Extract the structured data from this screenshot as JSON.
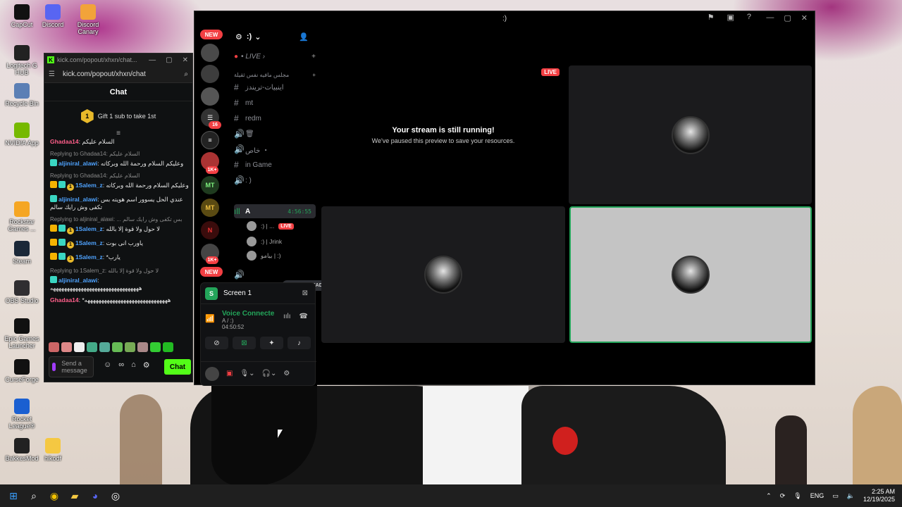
{
  "desktop": {
    "icons": [
      {
        "label": "CapCut",
        "color": "#111"
      },
      {
        "label": "Discord",
        "color": "#5865f2"
      },
      {
        "label": "Discord Canary",
        "color": "#f2a33a"
      },
      {
        "label": "Logitech G HUB",
        "color": "#222"
      },
      {
        "label": "Recycle Bin",
        "color": "#5b7fb5"
      },
      {
        "label": "NVIDIA App",
        "color": "#76b900"
      },
      {
        "label": "Rockstar Games ...",
        "color": "#f5a623"
      },
      {
        "label": "Steam",
        "color": "#1b2838"
      },
      {
        "label": "OBS Studio",
        "color": "#302e31"
      },
      {
        "label": "Epic Games Launcher",
        "color": "#111"
      },
      {
        "label": "CurseForge",
        "color": "#111"
      },
      {
        "label": "Rocket League®",
        "color": "#1a5fd1"
      },
      {
        "label": "BakkesMod",
        "color": "#222"
      },
      {
        "label": "hikodf",
        "color": "#f5c842"
      }
    ]
  },
  "kick": {
    "title": "kick.com/popout/xhxn/chat...",
    "url": "kick.com/popout/xhxn/chat",
    "chat_header": "Chat",
    "gift": {
      "badge": "1",
      "text": "Gift 1 sub to take 1st"
    },
    "messages": [
      {
        "reply": "",
        "user": "Ghadaa14",
        "color": "pink",
        "text": "السلام عليكم"
      },
      {
        "reply": "Replying to Ghadaa14: السلام عليكم",
        "user": "aljiniral_alawi",
        "color": "blue",
        "text": "وعليكم السلام ورحمة الله وبركاته"
      },
      {
        "reply": "Replying to Ghadaa14: السلام عليكم",
        "user": "1Salem_z",
        "color": "blue",
        "text": "وعليكم السلام ورحمة الله وبركاته"
      },
      {
        "reply": "",
        "user": "aljiniral_alawi",
        "color": "blue",
        "text": "عندي الحل يسوور اسم هويته بس تكفى وش رايك سالم"
      },
      {
        "reply": "Replying to aljiniral_alawi: ... بس تكفى وش رايك سالم",
        "user": "1Salem_z",
        "color": "blue",
        "text": "لا حول ولا قوة إلا بالله"
      },
      {
        "reply": "",
        "user": "1Salem_z",
        "color": "blue",
        "text": "ياورب انى بوت"
      },
      {
        "reply": "",
        "user": "1Salem_z",
        "color": "blue",
        "text": "يارب*"
      },
      {
        "reply": "Replying to 1Salem_z: لا حول ولا قوة إلا بالله",
        "user": "aljiniral_alawi",
        "color": "blue",
        "text": "ههههههههههههههههههههههههههههههههه"
      },
      {
        "reply": "",
        "user": "Ghadaa14",
        "color": "pink",
        "text": "ههههههههههههههههههههههههههههههه*"
      }
    ],
    "input_placeholder": "Send a message",
    "chat_button": "Chat"
  },
  "discord": {
    "window_title": ":)",
    "server_name": ":)",
    "new_badge": "NEW",
    "new_badge2": "NEW",
    "guild_counts": [
      "16",
      "1K+",
      "1K+"
    ],
    "live_category": "• LIVE ›",
    "category": "مجلس مافيه نفس ثقيلة",
    "channels": [
      {
        "icon": "#",
        "name": "اينبيات-تريندز"
      },
      {
        "icon": "#",
        "name": "mt"
      },
      {
        "icon": "#",
        "name": "redm"
      },
      {
        "icon": "🔊",
        "name": "🗑"
      },
      {
        "icon": "🔊",
        "name": "خاص ・"
      },
      {
        "icon": "#",
        "name": "in Game"
      },
      {
        "icon": "🔊",
        "name": ": )"
      }
    ],
    "active_channel": {
      "name": "A",
      "time": "4:56:55"
    },
    "voice_users": [
      {
        "name": ":) | ...",
        "live": "LIVE"
      },
      {
        "name": ":) | Jrink",
        "live": ""
      },
      {
        "name": "بيامو | :)",
        "live": ""
      }
    ],
    "new_unreads": "NEW UNREADS",
    "screen_label": "Screen 1",
    "voice_status": "Voice Connecte",
    "voice_sub": "A / :)",
    "voice_time": "04:50:52",
    "stream_title": "Your stream is still running!",
    "stream_sub": "We've paused this preview to save your resources.",
    "live_tag": "LIVE"
  },
  "taskbar": {
    "lang": "ENG",
    "time": "2:25 AM",
    "date": "12/19/2025"
  }
}
